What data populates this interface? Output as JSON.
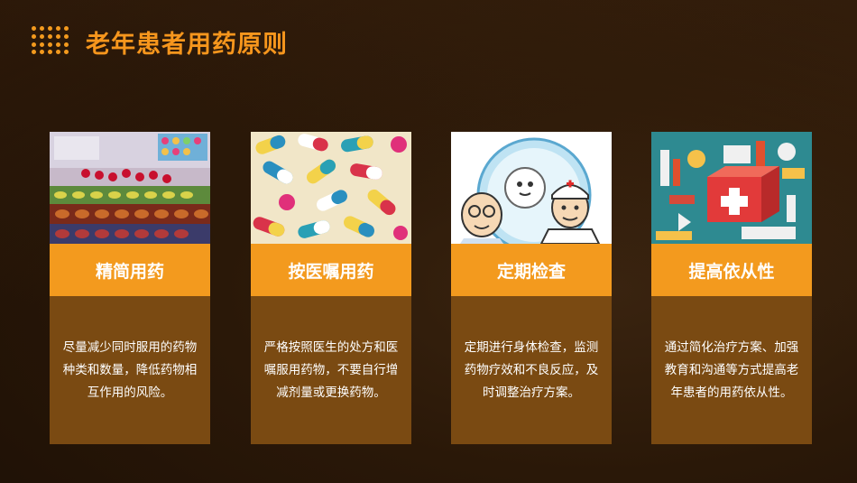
{
  "slide": {
    "title": "老年患者用药原则"
  },
  "cards": [
    {
      "heading": "精简用药",
      "text": "尽量减少同时服用的药物种类和数量，降低药物相互作用的风险。",
      "image_icon": "blister-packs-image"
    },
    {
      "heading": "按医嘱用药",
      "text": "严格按照医生的处方和医嘱服用药物，不要自行增减剂量或更换药物。",
      "image_icon": "capsules-image"
    },
    {
      "heading": "定期检查",
      "text": "定期进行身体检查，监测药物疗效和不良反应，及时调整治疗方案。",
      "image_icon": "doctor-patient-cartoon-image"
    },
    {
      "heading": "提高依从性",
      "text": "通过简化治疗方案、加强教育和沟通等方式提高老年患者的用药依从性。",
      "image_icon": "medical-kit-isometric-image"
    }
  ],
  "colors": {
    "accent": "#f39a1e",
    "card_body": "#7a4a12",
    "background": "#2a1808"
  }
}
